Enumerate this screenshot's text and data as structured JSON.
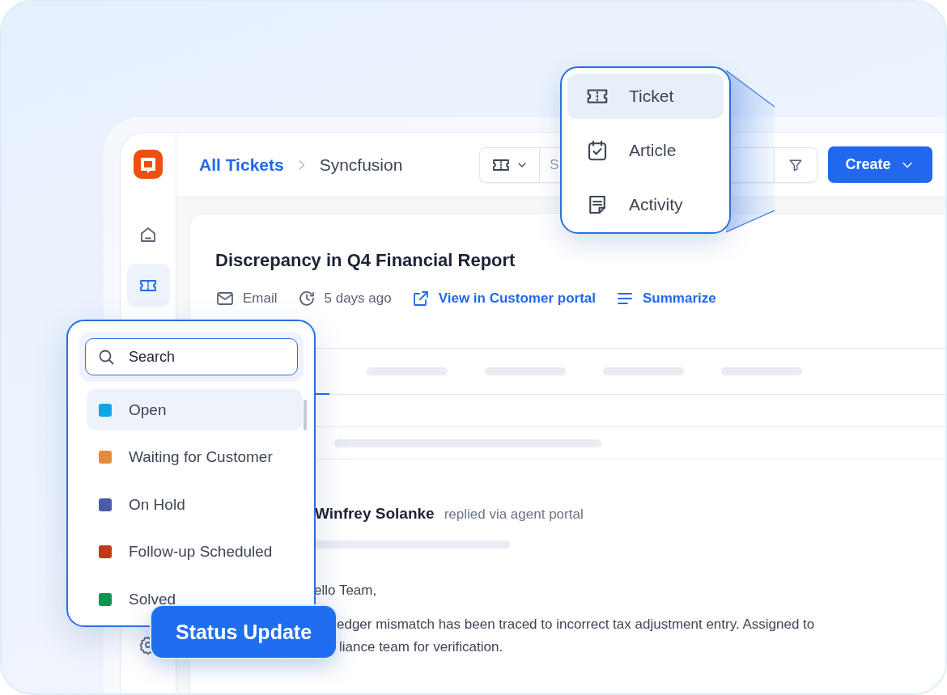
{
  "sidebar": {
    "items": [
      {
        "selected": false
      },
      {
        "selected": true
      },
      {
        "selected": false
      }
    ]
  },
  "header": {
    "breadcrumb": [
      {
        "kind": "link",
        "label": "All Tickets"
      },
      {
        "kind": "current",
        "label": "Syncfusion"
      }
    ],
    "search": {
      "placeholder": "S"
    },
    "create_button": "Create"
  },
  "ticket": {
    "title": "Discrepancy in Q4 Financial Report",
    "meta": [
      {
        "kind": "email",
        "label": "Email"
      },
      {
        "kind": "time",
        "label": "5 days ago"
      },
      {
        "kind": "external",
        "label": "View in Customer portal"
      },
      {
        "kind": "summary",
        "label": "Summarize"
      }
    ],
    "reply": {
      "author": "Winfrey Solanke",
      "via": "replied via agent portal",
      "greeting": "ello Team,",
      "lines": [
        "edger mismatch has been traced to incorrect tax adjustment entry. Assigned to",
        "liance team for verification."
      ]
    }
  },
  "create_menu": {
    "items": [
      {
        "label": "Ticket",
        "selected": true
      },
      {
        "label": "Article",
        "selected": false
      },
      {
        "label": "Activity",
        "selected": false
      }
    ]
  },
  "status_menu": {
    "search": {
      "placeholder": "Search"
    },
    "items": [
      {
        "label": "Open",
        "color": "#10a5e8",
        "selected": true
      },
      {
        "label": "Waiting for Customer",
        "color": "#e58c3a",
        "selected": false
      },
      {
        "label": "On Hold",
        "color": "#4c5aa8",
        "selected": false
      },
      {
        "label": "Follow-up Scheduled",
        "color": "#c2391a",
        "selected": false
      },
      {
        "label": "Solved",
        "color": "#0d9452",
        "selected": false
      }
    ]
  },
  "badge": "Status Update"
}
